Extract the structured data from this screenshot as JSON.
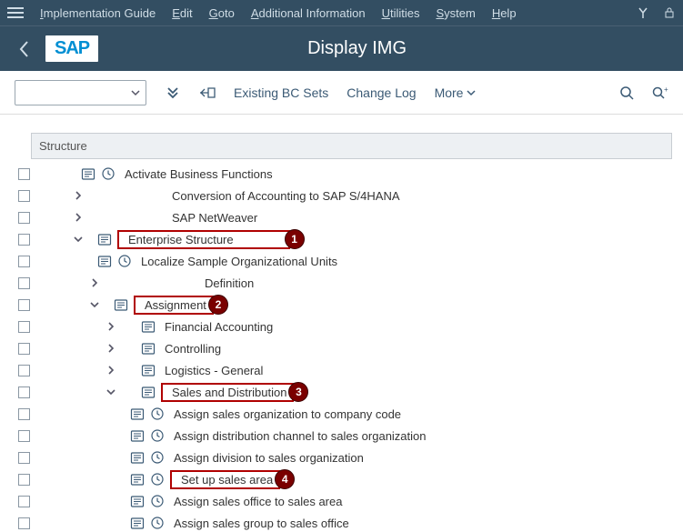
{
  "menubar": {
    "items": [
      "Implementation Guide",
      "Edit",
      "Goto",
      "Additional Information",
      "Utilities",
      "System",
      "Help"
    ]
  },
  "header": {
    "title": "Display IMG",
    "logo": "SAP"
  },
  "toolbar": {
    "existing_bc_sets": "Existing BC Sets",
    "change_log": "Change Log",
    "more": "More"
  },
  "structure_header": "Structure",
  "tree": [
    {
      "indent": 38,
      "expander": null,
      "icons": [
        "folder",
        "clock"
      ],
      "label": "Activate Business Functions",
      "highlight": false
    },
    {
      "indent": 28,
      "expander": "right",
      "icons": [],
      "label": "Conversion of Accounting to SAP S/4HANA",
      "highlight": false,
      "label_offset": 82
    },
    {
      "indent": 28,
      "expander": "right",
      "icons": [],
      "label": "SAP NetWeaver",
      "highlight": false,
      "label_offset": 82
    },
    {
      "indent": 28,
      "expander": "down",
      "icons": [
        "folder"
      ],
      "label": "Enterprise Structure",
      "highlight": true,
      "step": 1,
      "label_offset": 0,
      "highlight_wide": true
    },
    {
      "indent": 56,
      "expander": null,
      "icons": [
        "folder",
        "clock"
      ],
      "label": "Localize Sample Organizational Units",
      "highlight": false
    },
    {
      "indent": 46,
      "expander": "right",
      "icons": [],
      "label": "Definition",
      "highlight": false,
      "label_offset": 100
    },
    {
      "indent": 46,
      "expander": "down",
      "icons": [
        "folder"
      ],
      "label": "Assignment",
      "highlight": true,
      "step": 2,
      "label_offset": 0
    },
    {
      "indent": 64,
      "expander": "right",
      "icons": [
        "folder"
      ],
      "label": "Financial Accounting",
      "highlight": false,
      "label_offset": 0,
      "extra_gap": 18
    },
    {
      "indent": 64,
      "expander": "right",
      "icons": [
        "folder"
      ],
      "label": "Controlling",
      "highlight": false,
      "label_offset": 0,
      "extra_gap": 18
    },
    {
      "indent": 64,
      "expander": "right",
      "icons": [
        "folder"
      ],
      "label": "Logistics - General",
      "highlight": false,
      "label_offset": 0,
      "extra_gap": 18
    },
    {
      "indent": 64,
      "expander": "down",
      "icons": [
        "folder"
      ],
      "label": "Sales and Distribution",
      "highlight": true,
      "step": 3,
      "label_offset": 0,
      "extra_gap": 18
    },
    {
      "indent": 92,
      "expander": null,
      "icons": [
        "folder",
        "clock"
      ],
      "label": "Assign sales organization to company code",
      "highlight": false
    },
    {
      "indent": 92,
      "expander": null,
      "icons": [
        "folder",
        "clock"
      ],
      "label": "Assign distribution channel to sales organization",
      "highlight": false
    },
    {
      "indent": 92,
      "expander": null,
      "icons": [
        "folder",
        "clock"
      ],
      "label": "Assign division to sales organization",
      "highlight": false
    },
    {
      "indent": 92,
      "expander": null,
      "icons": [
        "folder",
        "clock"
      ],
      "label": "Set up sales area",
      "highlight": true,
      "step": 4
    },
    {
      "indent": 92,
      "expander": null,
      "icons": [
        "folder",
        "clock"
      ],
      "label": "Assign sales office to sales area",
      "highlight": false
    },
    {
      "indent": 92,
      "expander": null,
      "icons": [
        "folder",
        "clock"
      ],
      "label": "Assign sales group to sales office",
      "highlight": false
    }
  ]
}
